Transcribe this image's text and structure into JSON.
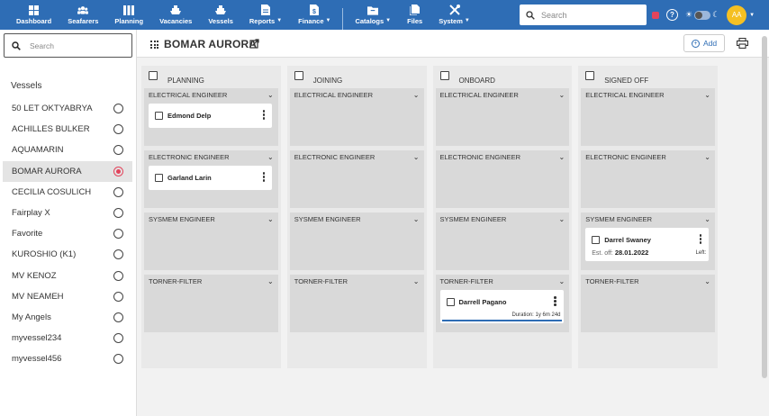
{
  "nav": [
    {
      "label": "Dashboard",
      "icon": "dashboard-icon",
      "caret": false
    },
    {
      "label": "Seafarers",
      "icon": "people-icon",
      "caret": false
    },
    {
      "label": "Planning",
      "icon": "columns-icon",
      "caret": false
    },
    {
      "label": "Vacancies",
      "icon": "ship-icon",
      "caret": false
    },
    {
      "label": "Vessels",
      "icon": "ship-icon",
      "caret": false
    },
    {
      "label": "Reports",
      "icon": "document-icon",
      "caret": true
    },
    {
      "label": "Finance",
      "icon": "finance-icon",
      "caret": true
    },
    {
      "label": "Catalogs",
      "icon": "folder-icon",
      "caret": true
    },
    {
      "label": "Files",
      "icon": "files-icon",
      "caret": false
    },
    {
      "label": "System",
      "icon": "tools-icon",
      "caret": true
    }
  ],
  "topsearch": {
    "placeholder": "Search"
  },
  "user": {
    "initials": "AA"
  },
  "sidebar": {
    "search_placeholder": "Search",
    "title": "Vessels",
    "items": [
      {
        "label": "50 LET OKTYABRYA",
        "selected": false
      },
      {
        "label": "ACHILLES BULKER",
        "selected": false
      },
      {
        "label": "AQUAMARIN",
        "selected": false
      },
      {
        "label": "BOMAR AURORA",
        "selected": true
      },
      {
        "label": "CECILIA COSULICH",
        "selected": false
      },
      {
        "label": "Fairplay X",
        "selected": false
      },
      {
        "label": "Favorite",
        "selected": false
      },
      {
        "label": "KUROSHIO (K1)",
        "selected": false
      },
      {
        "label": "MV KENOZ",
        "selected": false
      },
      {
        "label": "MV NEAMEH",
        "selected": false
      },
      {
        "label": "My Angels",
        "selected": false
      },
      {
        "label": "myvessel234",
        "selected": false
      },
      {
        "label": "myvessel456",
        "selected": false
      }
    ]
  },
  "header": {
    "vessel_name": "BOMAR AURORA",
    "add_label": "Add"
  },
  "columns": [
    {
      "title": "PLANNING",
      "lanes": [
        {
          "title": "ELECTRICAL ENGINEER",
          "card": {
            "name": "Edmond Delp"
          }
        },
        {
          "title": "ELECTRONIC ENGINEER",
          "card": {
            "name": "Garland Larin"
          }
        },
        {
          "title": "SYSMEM ENGINEER",
          "card": null
        },
        {
          "title": "TORNER-FILTER",
          "card": null
        }
      ]
    },
    {
      "title": "JOINING",
      "lanes": [
        {
          "title": "ELECTRICAL ENGINEER",
          "card": null
        },
        {
          "title": "ELECTRONIC ENGINEER",
          "card": null
        },
        {
          "title": "SYSMEM ENGINEER",
          "card": null
        },
        {
          "title": "TORNER-FILTER",
          "card": null
        }
      ]
    },
    {
      "title": "ONBOARD",
      "lanes": [
        {
          "title": "ELECTRICAL ENGINEER",
          "card": null
        },
        {
          "title": "ELECTRONIC ENGINEER",
          "card": null
        },
        {
          "title": "SYSMEM ENGINEER",
          "card": null
        },
        {
          "title": "TORNER-FILTER",
          "card": {
            "name": "Darrell Pagano",
            "duration": "Duration: 1y 6m 24d"
          }
        }
      ]
    },
    {
      "title": "SIGNED OFF",
      "lanes": [
        {
          "title": "ELECTRICAL ENGINEER",
          "card": null
        },
        {
          "title": "ELECTRONIC ENGINEER",
          "card": null
        },
        {
          "title": "SYSMEM ENGINEER",
          "card": {
            "name": "Darrel Swaney",
            "est_label": "Est. off:",
            "est_date": "28.01.2022",
            "left": "Left:"
          }
        },
        {
          "title": "TORNER-FILTER",
          "card": null
        }
      ]
    }
  ],
  "colors": {
    "topbar": "#2e6db5",
    "selected_radio": "#e2445c",
    "avatar": "#f5c023"
  }
}
